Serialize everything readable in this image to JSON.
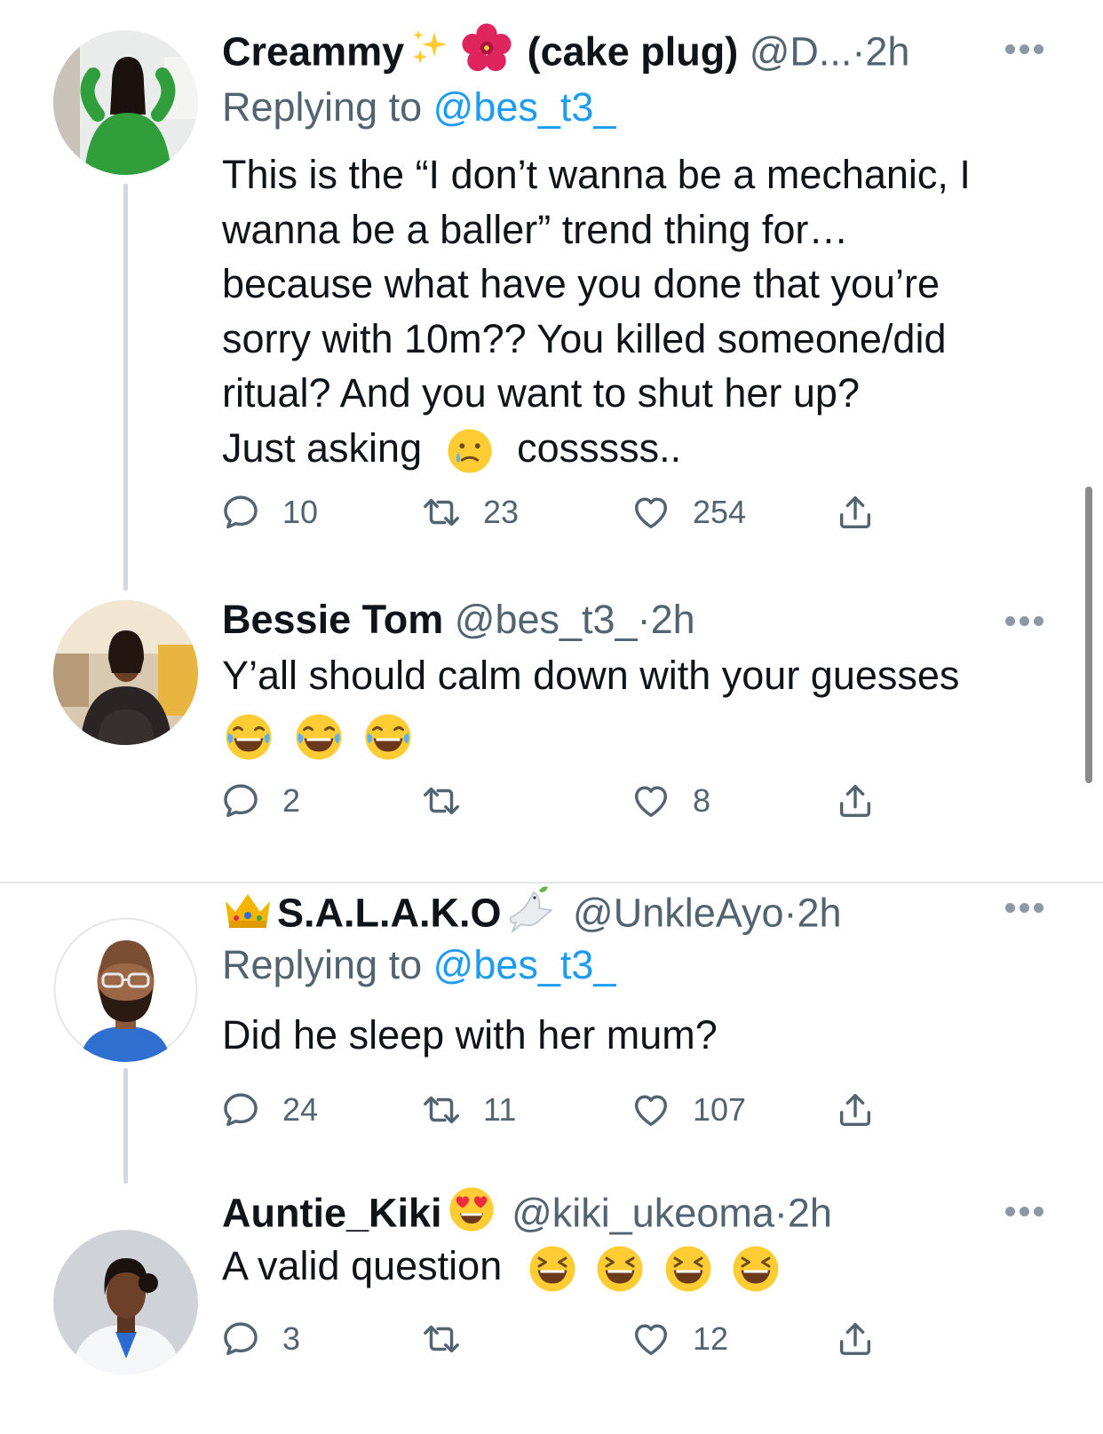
{
  "tweets": [
    {
      "name": "Creammy",
      "name_suffix": "(cake plug)",
      "handle": "@D...",
      "time": "2h",
      "replying_prefix": "Replying to",
      "replying_handle": "@bes_t3_",
      "text_lines": [
        "This is the “I don’t wanna be a mechanic, I",
        "wanna be a baller” trend thing for…",
        "because what have you done that you’re",
        "sorry with 10m?? You killed someone/did",
        "ritual? And you want to shut her up?"
      ],
      "last_line_start": "Just asking",
      "last_line_end": "cosssss..",
      "replies": "10",
      "retweets": "23",
      "likes": "254"
    },
    {
      "name": "Bessie Tom",
      "handle": "@bes_t3_",
      "time": "2h",
      "text": "Y’all should calm down with your guesses",
      "replies": "2",
      "retweets": "",
      "likes": "8"
    },
    {
      "name": "S.A.L.A.K.O",
      "handle": "@UnkleAyo",
      "time": "2h",
      "replying_prefix": "Replying to",
      "replying_handle": "@bes_t3_",
      "text": "Did he sleep with her mum?",
      "replies": "24",
      "retweets": "11",
      "likes": "107"
    },
    {
      "name": "Auntie_Kiki",
      "handle": "@kiki_ukeoma",
      "time": "2h",
      "text": "A valid question",
      "replies": "3",
      "retweets": "",
      "likes": "12"
    }
  ],
  "separator": "·",
  "icons": {
    "reply": "reply-icon",
    "retweet": "retweet-icon",
    "like": "heart-icon",
    "share": "share-icon",
    "more": "more-options-icon"
  },
  "colors": {
    "link": "#1d9bf0",
    "secondary_text": "#536471",
    "thread_line": "#cfd9de"
  }
}
